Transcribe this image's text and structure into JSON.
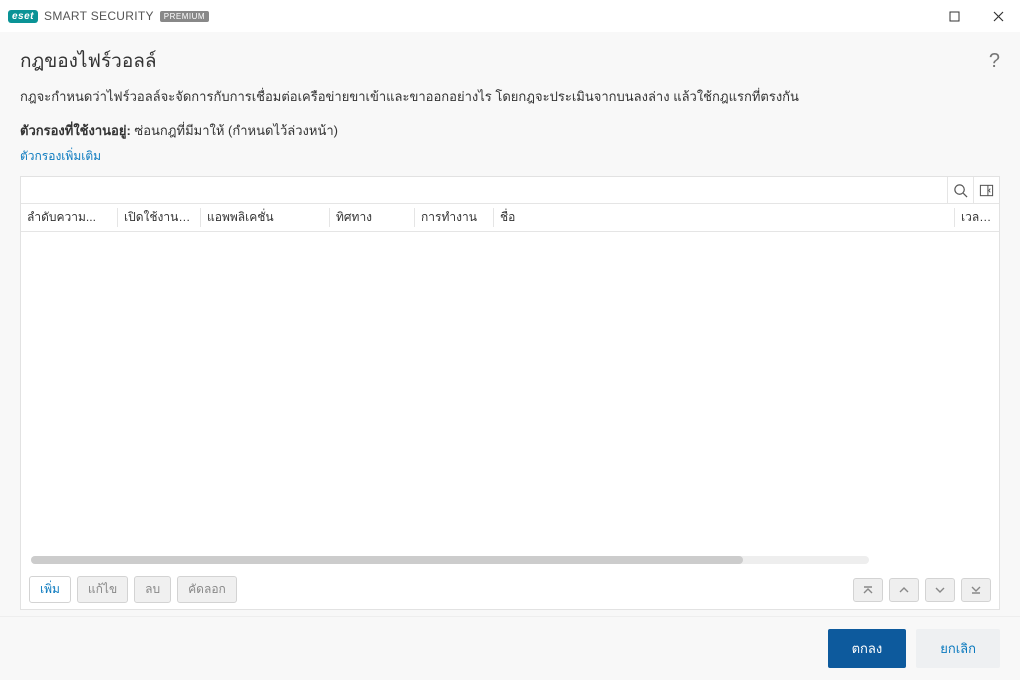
{
  "titlebar": {
    "brand_pill": "eset",
    "brand_text_html": "SMART SECURITY",
    "premium_label": "PREMIUM"
  },
  "page": {
    "heading": "กฎของไฟร์วอลล์",
    "description": "กฎจะกำหนดว่าไฟร์วอลล์จะจัดการกับการเชื่อมต่อเครือข่ายขาเข้าและขาออกอย่างไร โดยกฎจะประเมินจากบนลงล่าง แล้วใช้กฎแรกที่ตรงกัน",
    "filter_label": "ตัวกรองที่ใช้งานอยู่:",
    "filter_value": "ซ่อนกฎที่มีมาให้ (กำหนดไว้ล่วงหน้า)",
    "more_filters": "ตัวกรองเพิ่มเติม"
  },
  "table": {
    "columns": {
      "priority": "ลำดับความ...",
      "enabled": "เปิดใช้งานแล้ว",
      "application": "แอพพลิเคชั่น",
      "direction": "ทิศทาง",
      "action": "การทำงาน",
      "name": "ชื่อ",
      "time": "เวลาที่ป"
    }
  },
  "toolbar": {
    "add": "เพิ่ม",
    "edit": "แก้ไข",
    "delete": "ลบ",
    "copy": "คัดลอก"
  },
  "footer": {
    "ok": "ตกลง",
    "cancel": "ยกเลิก"
  }
}
